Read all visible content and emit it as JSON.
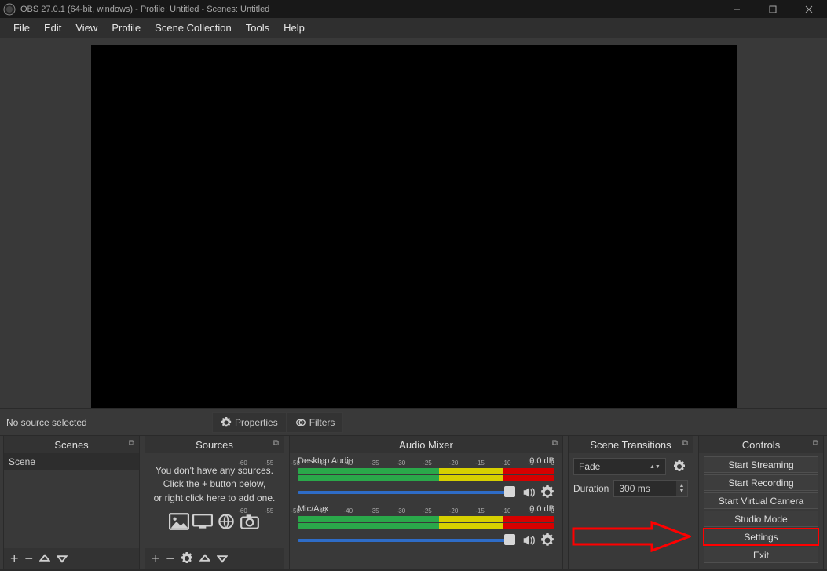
{
  "window": {
    "title": "OBS 27.0.1 (64-bit, windows) - Profile: Untitled - Scenes: Untitled"
  },
  "menu": {
    "items": [
      "File",
      "Edit",
      "View",
      "Profile",
      "Scene Collection",
      "Tools",
      "Help"
    ]
  },
  "status": {
    "no_source": "No source selected",
    "properties": "Properties",
    "filters": "Filters"
  },
  "docks": {
    "scenes": {
      "title": "Scenes",
      "items": [
        "Scene"
      ]
    },
    "sources": {
      "title": "Sources",
      "empty_line1": "You don't have any sources.",
      "empty_line2": "Click the + button below,",
      "empty_line3": "or right click here to add one."
    },
    "mixer": {
      "title": "Audio Mixer",
      "tracks": [
        {
          "name": "Desktop Audio",
          "level": "0.0 dB",
          "ticks": [
            "-60",
            "-55",
            "-50",
            "-45",
            "-40",
            "-35",
            "-30",
            "-25",
            "-20",
            "-15",
            "-10",
            "-5",
            "0"
          ]
        },
        {
          "name": "Mic/Aux",
          "level": "0.0 dB",
          "ticks": [
            "-60",
            "-55",
            "-50",
            "-45",
            "-40",
            "-35",
            "-30",
            "-25",
            "-20",
            "-15",
            "-10",
            "-5",
            "0"
          ]
        }
      ]
    },
    "transitions": {
      "title": "Scene Transitions",
      "type": "Fade",
      "duration_label": "Duration",
      "duration_value": "300 ms"
    },
    "controls": {
      "title": "Controls",
      "buttons": [
        "Start Streaming",
        "Start Recording",
        "Start Virtual Camera",
        "Studio Mode",
        "Settings",
        "Exit"
      ],
      "highlight_index": 4
    }
  }
}
